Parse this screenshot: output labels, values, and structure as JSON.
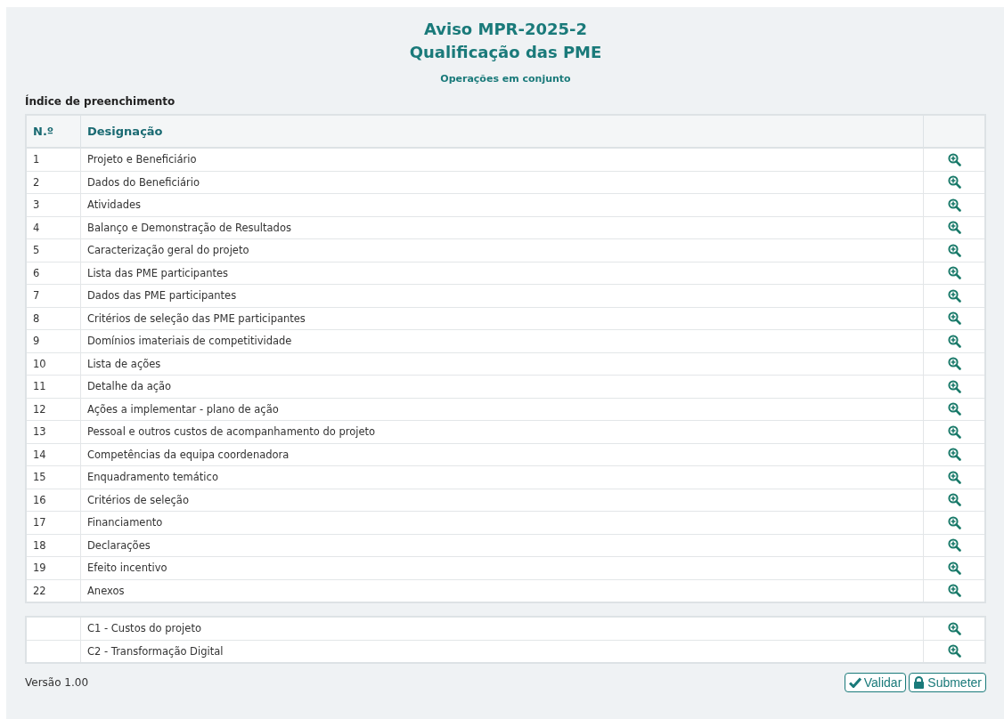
{
  "header": {
    "title_lines": [
      "Aviso MPR-2025-2",
      "Qualificação das PME"
    ],
    "subtitle": "Operações em conjunto"
  },
  "index": {
    "heading": "Índice de preenchimento",
    "columns": [
      "N.º",
      "Designação"
    ],
    "rows": [
      {
        "number": "1",
        "label": "Projeto e Beneficiário"
      },
      {
        "number": "2",
        "label": "Dados do Beneficiário"
      },
      {
        "number": "3",
        "label": "Atividades"
      },
      {
        "number": "4",
        "label": "Balanço e Demonstração de Resultados"
      },
      {
        "number": "5",
        "label": "Caracterização geral do projeto"
      },
      {
        "number": "6",
        "label": "Lista das PME participantes"
      },
      {
        "number": "7",
        "label": "Dados das PME participantes"
      },
      {
        "number": "8",
        "label": "Critérios de seleção das PME participantes"
      },
      {
        "number": "9",
        "label": "Domínios imateriais de competitividade"
      },
      {
        "number": "10",
        "label": "Lista de ações"
      },
      {
        "number": "11",
        "label": "Detalhe da ação"
      },
      {
        "number": "12",
        "label": "Ações a implementar - plano de ação"
      },
      {
        "number": "13",
        "label": "Pessoal e outros custos de acompanhamento do projeto"
      },
      {
        "number": "14",
        "label": "Competências da equipa coordenadora"
      },
      {
        "number": "15",
        "label": "Enquadramento temático"
      },
      {
        "number": "16",
        "label": "Critérios de seleção"
      },
      {
        "number": "17",
        "label": "Financiamento"
      },
      {
        "number": "18",
        "label": "Declarações"
      },
      {
        "number": "19",
        "label": "Efeito incentivo"
      },
      {
        "number": "22",
        "label": "Anexos"
      }
    ]
  },
  "extra_rows": [
    {
      "label": "C1 - Custos do projeto"
    },
    {
      "label": "C2 - Transformação Digital"
    }
  ],
  "footer": {
    "version": "Versão 1.00",
    "buttons": [
      {
        "kind": "validate",
        "label": "Validar"
      },
      {
        "kind": "submit",
        "label": "Submeter"
      }
    ]
  }
}
